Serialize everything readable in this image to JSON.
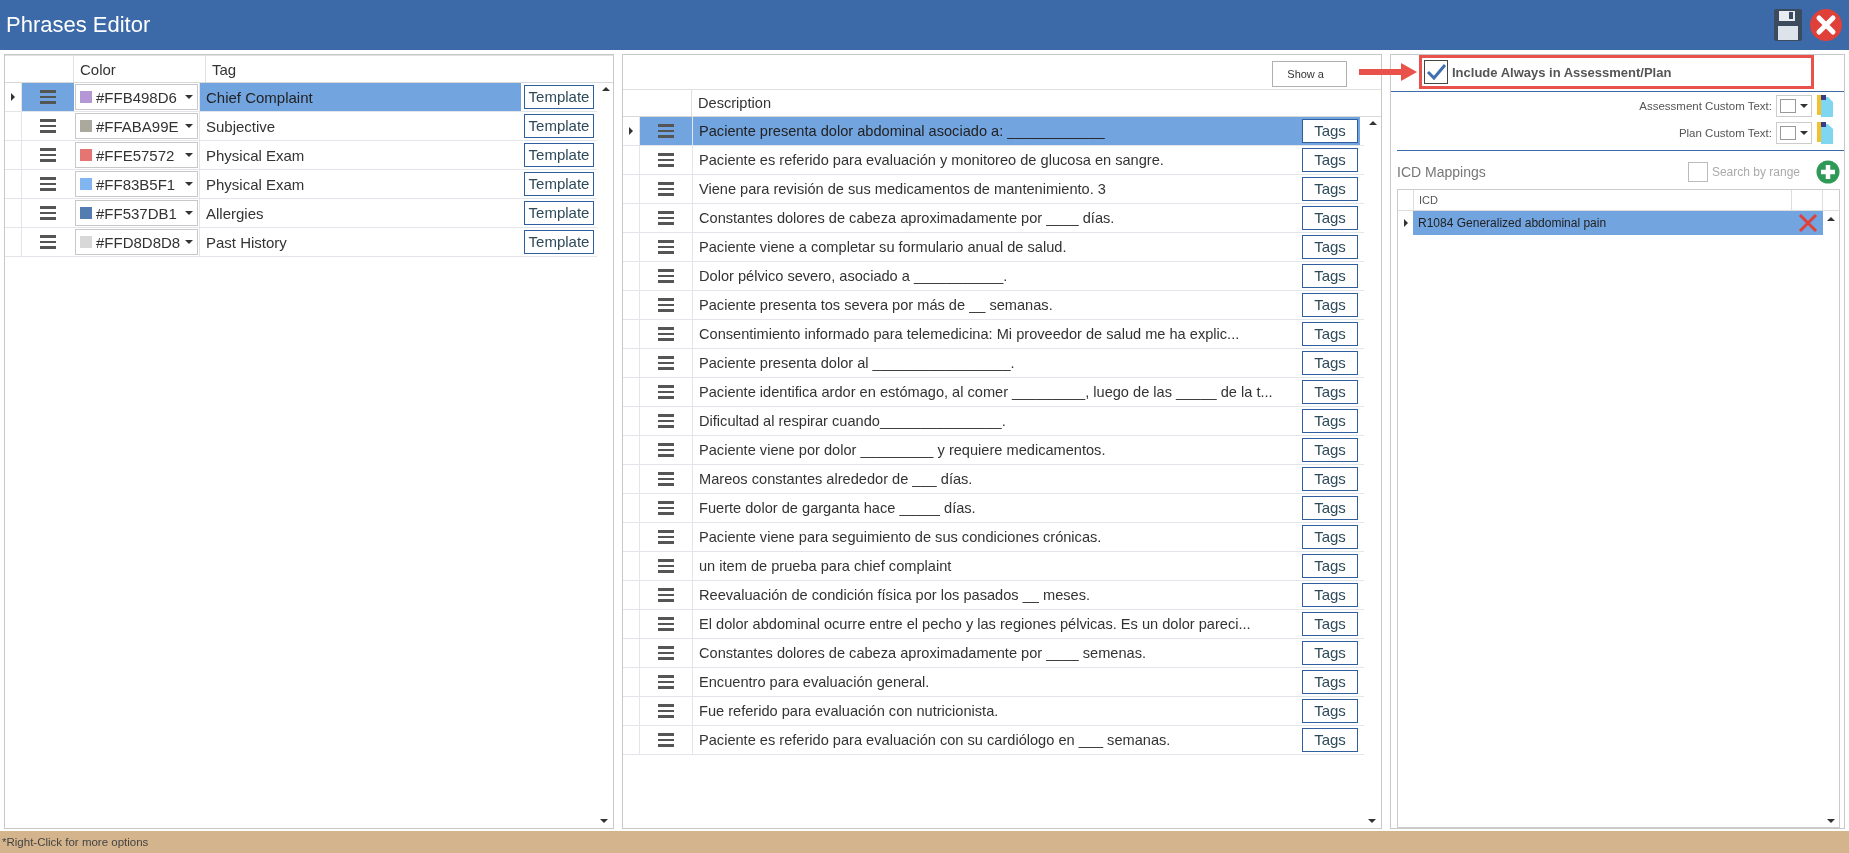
{
  "window": {
    "title": "Phrases Editor"
  },
  "tags_table": {
    "columns": [
      "Color",
      "Tag"
    ],
    "rows": [
      {
        "color_code": "#FFB498D6",
        "color": "#b498d6",
        "tag": "Chief Complaint",
        "button": "Template",
        "selected": true
      },
      {
        "color_code": "#FFABA99E",
        "color": "#aba99e",
        "tag": "Subjective",
        "button": "Template",
        "selected": false
      },
      {
        "color_code": "#FFE57572",
        "color": "#e57572",
        "tag": "Physical Exam",
        "button": "Template",
        "selected": false
      },
      {
        "color_code": "#FF83B5F1",
        "color": "#83b5f1",
        "tag": "Physical Exam",
        "button": "Template",
        "selected": false
      },
      {
        "color_code": "#FF537DB1",
        "color": "#537db1",
        "tag": "Allergies",
        "button": "Template",
        "selected": false
      },
      {
        "color_code": "#FFD8D8D8",
        "color": "#d8d8d8",
        "tag": "Past History",
        "button": "Template",
        "selected": false
      }
    ]
  },
  "phrases_table": {
    "show_button": "Show a",
    "columns": [
      "Description"
    ],
    "rows": [
      {
        "description": "Paciente presenta dolor abdominal asociado a: ____________",
        "button": "Tags",
        "selected": true
      },
      {
        "description": "Paciente es referido para evaluación y monitoreo de glucosa en sangre.",
        "button": "Tags",
        "selected": false
      },
      {
        "description": "Viene para revisión de sus medicamentos de mantenimiento. 3",
        "button": "Tags",
        "selected": false
      },
      {
        "description": "Constantes dolores de cabeza aproximadamente por ____ días.",
        "button": "Tags",
        "selected": false
      },
      {
        "description": "Paciente viene a completar su formulario anual de salud.",
        "button": "Tags",
        "selected": false
      },
      {
        "description": "Dolor pélvico severo, asociado a ___________.",
        "button": "Tags",
        "selected": false
      },
      {
        "description": "Paciente presenta tos severa por más de __ semanas.",
        "button": "Tags",
        "selected": false
      },
      {
        "description": "Consentimiento informado para telemedicina:  Mi proveedor de salud me ha explic...",
        "button": "Tags",
        "selected": false
      },
      {
        "description": "Paciente presenta dolor al _________________.",
        "button": "Tags",
        "selected": false
      },
      {
        "description": "Paciente identifica ardor en estómago, al comer _________, luego de las _____ de la t...",
        "button": "Tags",
        "selected": false
      },
      {
        "description": "Dificultad al respirar cuando_______________.",
        "button": "Tags",
        "selected": false
      },
      {
        "description": "Paciente viene por dolor _________ y requiere medicamentos.",
        "button": "Tags",
        "selected": false
      },
      {
        "description": "Mareos constantes alrededor de ___ días.",
        "button": "Tags",
        "selected": false
      },
      {
        "description": "Fuerte dolor de garganta hace _____ días.",
        "button": "Tags",
        "selected": false
      },
      {
        "description": "Paciente viene para seguimiento de sus condiciones crónicas.",
        "button": "Tags",
        "selected": false
      },
      {
        "description": "un item de prueba para chief complaint",
        "button": "Tags",
        "selected": false
      },
      {
        "description": "Reevaluación de condición física por los pasados __ meses.",
        "button": "Tags",
        "selected": false
      },
      {
        "description": "El dolor abdominal ocurre entre el pecho y las regiones pélvicas. Es un dolor pareci...",
        "button": "Tags",
        "selected": false
      },
      {
        "description": "Constantes dolores de cabeza aproximadamente por ____ semenas.",
        "button": "Tags",
        "selected": false
      },
      {
        "description": "Encuentro para evaluación general.",
        "button": "Tags",
        "selected": false
      },
      {
        "description": "Fue referido para evaluación con nutricionista.",
        "button": "Tags",
        "selected": false
      },
      {
        "description": "Paciente es referido para evaluación con su cardiólogo en ___ semanas.",
        "button": "Tags",
        "selected": false
      }
    ]
  },
  "options": {
    "include_always": {
      "label": "Include Always in Assessment/Plan",
      "checked": true
    },
    "assessment_custom_text": {
      "label": "Assessment Custom Text:"
    },
    "plan_custom_text": {
      "label": "Plan Custom Text:"
    }
  },
  "icd": {
    "title": "ICD Mappings",
    "search_by_range": {
      "label": "Search by range",
      "checked": false
    },
    "columns": [
      "ICD"
    ],
    "rows": [
      {
        "text": "R1084 Generalized abdominal pain",
        "selected": true
      }
    ]
  },
  "status_bar": "*Right-Click for more options"
}
